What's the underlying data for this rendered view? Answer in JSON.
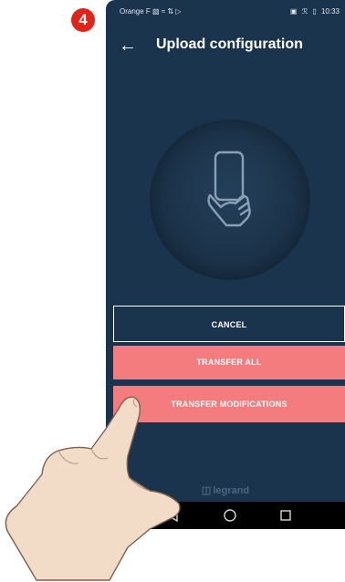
{
  "step_badge": "4",
  "status_bar": {
    "carrier": "Orange F",
    "time": "10:33",
    "left_icons": [
      "signal-icon",
      "wifi-icon",
      "data-icon",
      "cast-icon"
    ],
    "right_icons": [
      "nfc-icon",
      "bluetooth-icon",
      "battery-icon"
    ]
  },
  "header": {
    "title": "Upload configuration",
    "back_icon": "arrow-left-icon"
  },
  "illustration": {
    "icon": "hand-holding-phone-icon"
  },
  "buttons": {
    "cancel": "CANCEL",
    "transfer_all": "TRANSFER ALL",
    "transfer_modifications": "TRANSFER MODIFICATIONS"
  },
  "brand": "legrand",
  "nav_bar": {
    "icons": [
      "back-triangle-icon",
      "home-circle-icon",
      "recent-square-icon"
    ]
  },
  "colors": {
    "background": "#1b344d",
    "accent_button": "#f57c7e",
    "badge": "#e2231a",
    "brand_text": "#4f6580"
  }
}
